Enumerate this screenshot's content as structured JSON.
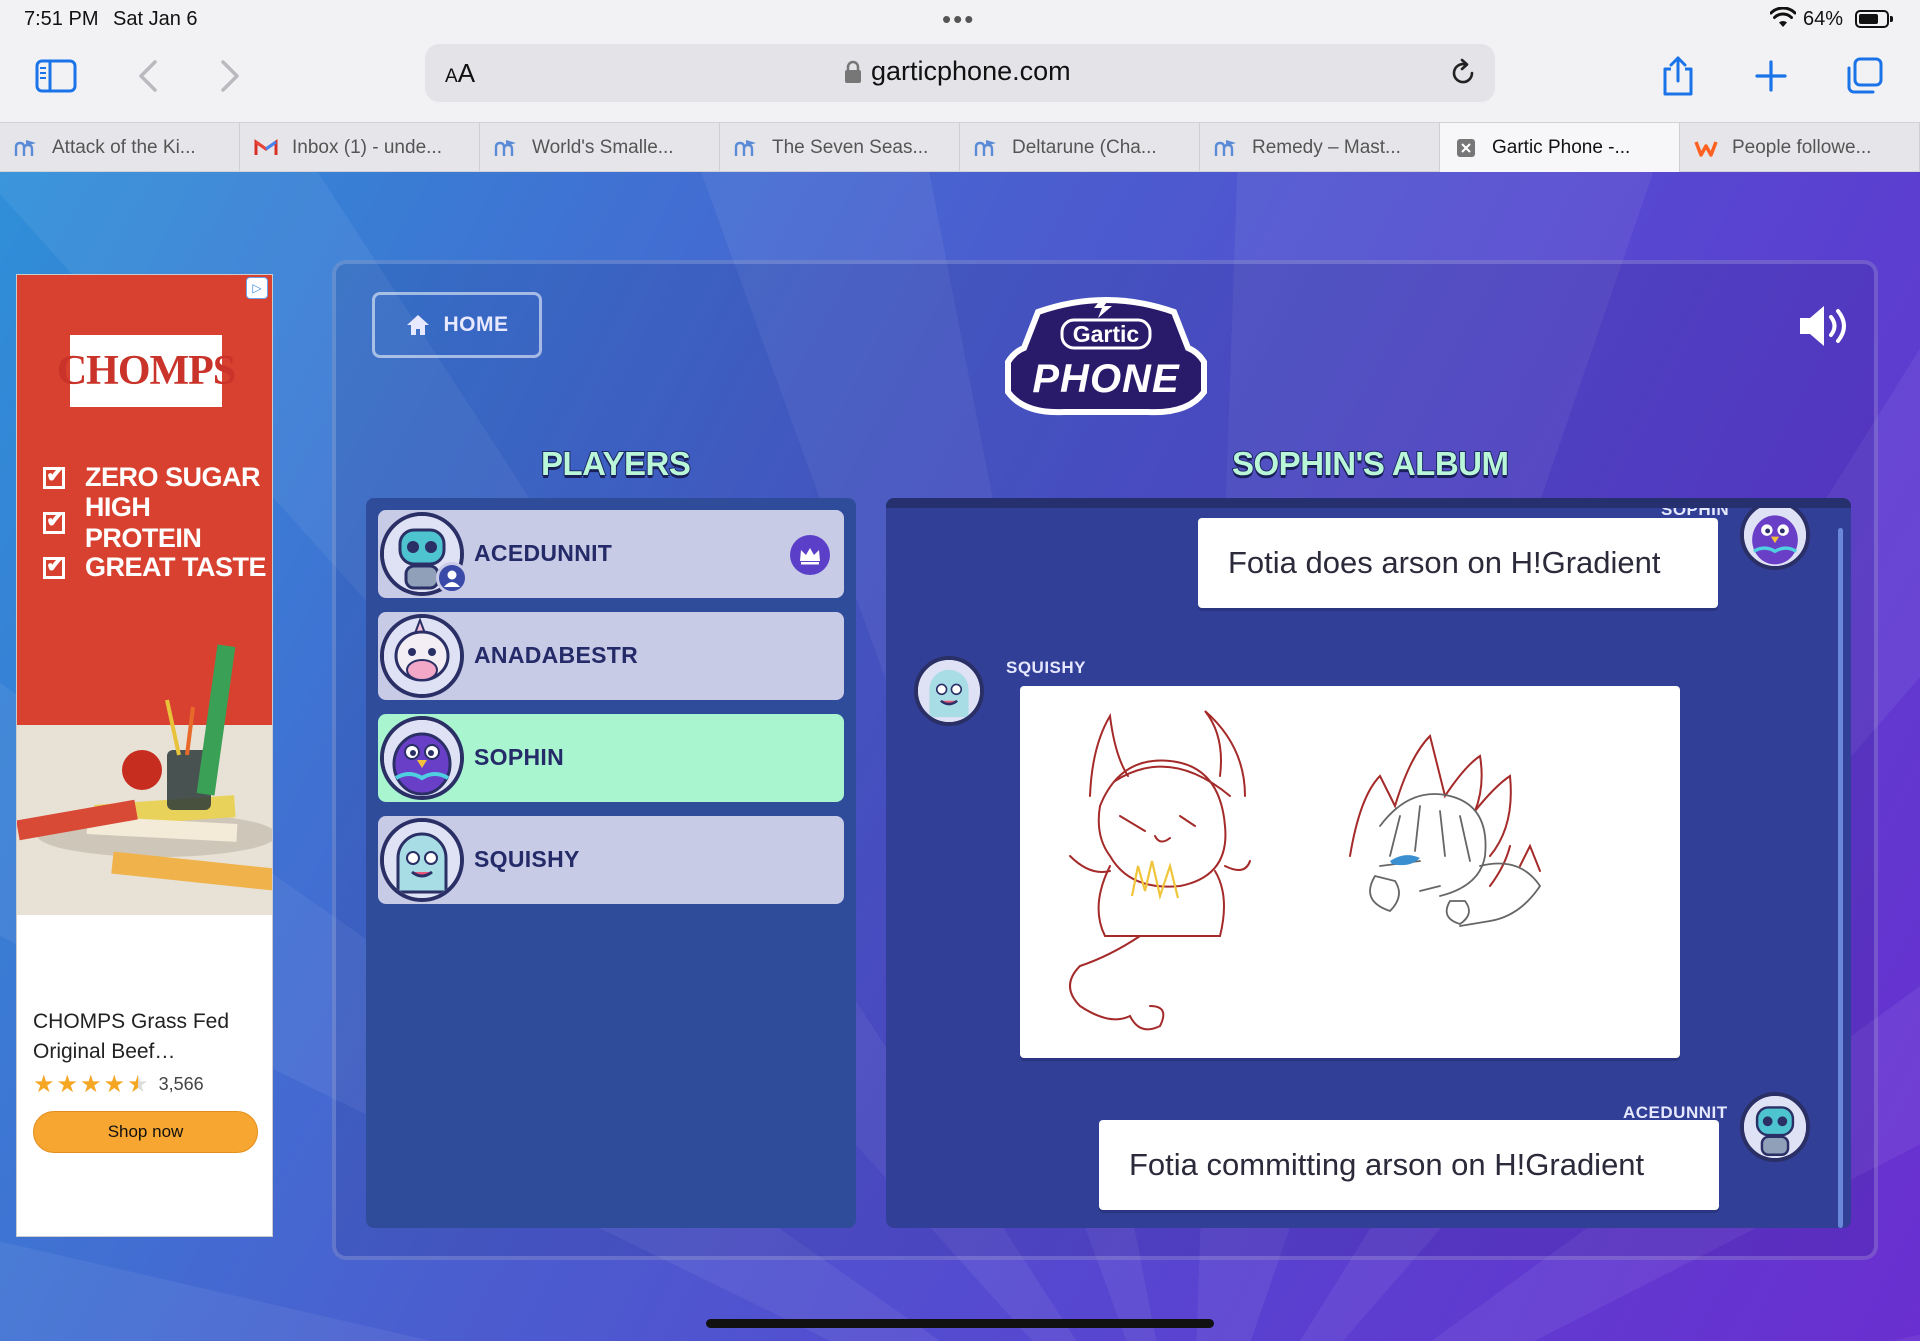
{
  "status_bar": {
    "time": "7:51 PM",
    "date": "Sat Jan 6",
    "battery": "64%",
    "battery_level": 0.64
  },
  "browser": {
    "aa_label": "A",
    "aa_label_big": "A",
    "url": "garticphone.com",
    "icons": [
      "sidebar-icon",
      "back-icon",
      "forward-icon",
      "lock-icon",
      "reload-icon",
      "share-icon",
      "new-tab-icon",
      "tabs-overview-icon"
    ]
  },
  "tabs": [
    {
      "title": "Attack of the Ki...",
      "favicon": "moodle",
      "active": false
    },
    {
      "title": "Inbox (1) - unde...",
      "favicon": "gmail",
      "active": false
    },
    {
      "title": "World's Smalle...",
      "favicon": "moodle",
      "active": false
    },
    {
      "title": "The Seven Seas...",
      "favicon": "moodle",
      "active": false
    },
    {
      "title": "Deltarune (Cha...",
      "favicon": "moodle",
      "active": false
    },
    {
      "title": "Remedy – Mast...",
      "favicon": "moodle",
      "active": false
    },
    {
      "title": "Gartic Phone -...",
      "favicon": "close",
      "active": true
    },
    {
      "title": "People followe...",
      "favicon": "wattpad",
      "active": false
    }
  ],
  "ad": {
    "brand": "CHOMPS",
    "bullets": [
      "ZERO SUGAR",
      "HIGH PROTEIN",
      "GREAT TASTE"
    ],
    "product_title": "CHOMPS Grass Fed Original Beef…",
    "rating": 4.5,
    "reviews": "3,566",
    "cta": "Shop now",
    "accent": "#d8412f"
  },
  "game": {
    "home_label": "HOME",
    "logo_top": "Gartic",
    "logo_bottom": "PHONE",
    "players_title": "PLAYERS",
    "album_title": "SOPHIN'S ALBUM",
    "players": [
      {
        "name": "ACEDUNNIT",
        "avatar": "robot",
        "host": true,
        "active": false
      },
      {
        "name": "ANADABESTR",
        "avatar": "unicorn-cow",
        "host": false,
        "active": false
      },
      {
        "name": "SOPHIN",
        "avatar": "purple-bird",
        "host": false,
        "active": true
      },
      {
        "name": "SQUISHY",
        "avatar": "ghost",
        "host": false,
        "active": false
      }
    ],
    "album": [
      {
        "author": "SOPHIN",
        "type": "text",
        "text": "Fotia does arson on H!Gradient"
      },
      {
        "author": "SQUISHY",
        "type": "drawing"
      },
      {
        "author": "ACEDUNNIT",
        "type": "text",
        "text": "Fotia committing arson on H!Gradient"
      }
    ],
    "colors": {
      "active_player": "#a8f5d0",
      "title_fill": "#b9f7d8",
      "panel": "#2f4c9a"
    }
  }
}
